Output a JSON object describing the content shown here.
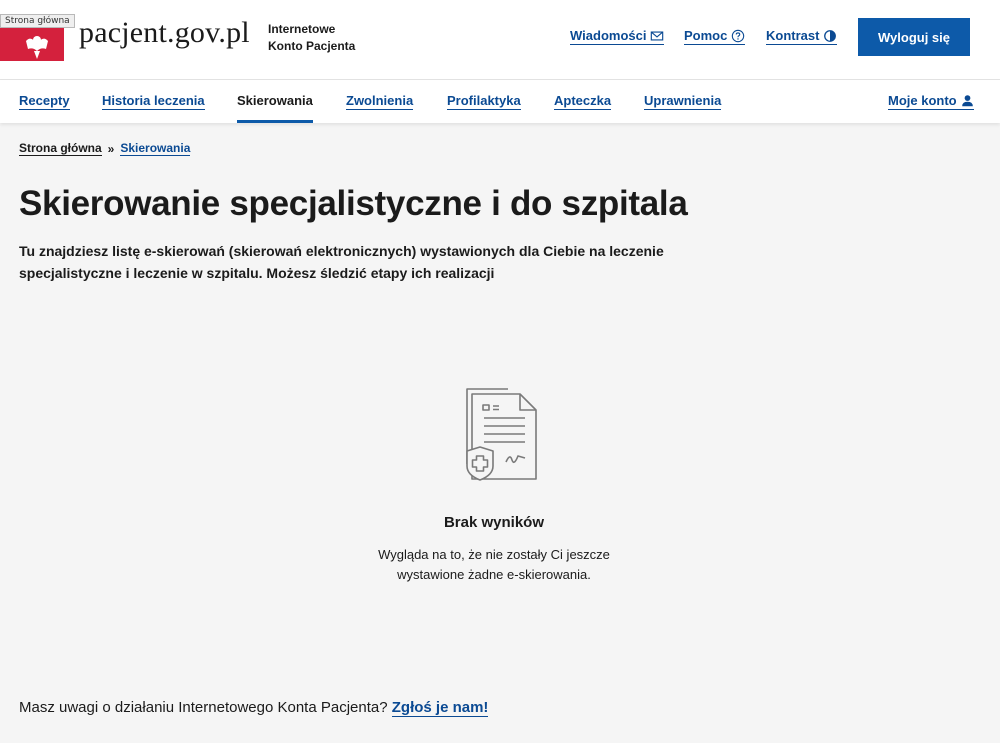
{
  "header": {
    "tooltip": "Strona główna",
    "site_name": "pacjent.gov.pl",
    "site_sub_line1": "Internetowe",
    "site_sub_line2": "Konto Pacjenta",
    "links": {
      "messages": "Wiadomości",
      "help": "Pomoc",
      "contrast": "Kontrast"
    },
    "logout_label": "Wyloguj się"
  },
  "nav": {
    "items": [
      "Recepty",
      "Historia leczenia",
      "Skierowania",
      "Zwolnienia",
      "Profilaktyka",
      "Apteczka",
      "Uprawnienia"
    ],
    "active": "Skierowania",
    "account": "Moje konto"
  },
  "breadcrumb": {
    "home": "Strona główna",
    "separator": "»",
    "current": "Skierowania"
  },
  "main": {
    "title": "Skierowanie specjalistyczne i do szpitala",
    "description": "Tu znajdziesz listę e-skierowań (skierowań elektronicznych) wystawionych dla Ciebie na leczenie specjalistyczne i leczenie w szpitalu. Możesz śledzić etapy ich realizacji"
  },
  "empty_state": {
    "icon": "referral-document-icon",
    "title": "Brak wyników",
    "text_line1": "Wygląda na to, że nie zostały Ci jeszcze",
    "text_line2": "wystawione żadne e-skierowania."
  },
  "feedback": {
    "text": "Masz uwagi o działaniu Internetowego Konta Pacjenta?",
    "link": "Zgłoś je nam!"
  },
  "colors": {
    "primary": "#0d5aa9",
    "link": "#0b4a93",
    "flag_red": "#d4213d",
    "background": "#f5f5f5"
  }
}
